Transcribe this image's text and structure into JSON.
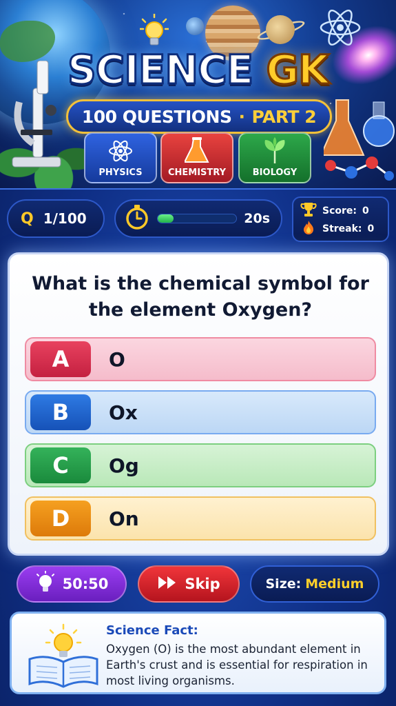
{
  "header": {
    "title_word1": "SCIENCE",
    "title_word2": "GK",
    "subtitle_left": "100 QUESTIONS",
    "subtitle_sep": "·",
    "subtitle_right": "PART 2",
    "categories": [
      {
        "label": "PHYSICS",
        "icon": "atom-icon",
        "color": "#2f63e0"
      },
      {
        "label": "CHEMISTRY",
        "icon": "flask-icon",
        "color": "#e8433f"
      },
      {
        "label": "BIOLOGY",
        "icon": "leaf-icon",
        "color": "#2da84a"
      }
    ]
  },
  "status": {
    "q_badge": "Q",
    "question_counter": "1/100",
    "timer_value": "20s",
    "timer_fraction": 0.2,
    "score_label": "Score:",
    "score_value": "0",
    "streak_label": "Streak:",
    "streak_value": "0"
  },
  "question": {
    "text": "What is the chemical symbol for the element Oxygen?",
    "options": [
      {
        "letter": "A",
        "text": "O",
        "color": "#e8425f"
      },
      {
        "letter": "B",
        "text": "Ox",
        "color": "#2e7ae3"
      },
      {
        "letter": "C",
        "text": "Og",
        "color": "#34b25a"
      },
      {
        "letter": "D",
        "text": "On",
        "color": "#f5a020"
      }
    ]
  },
  "controls": {
    "fifty_fifty_label": "50:50",
    "skip_label": "Skip",
    "size_label": "Size:",
    "size_value": "Medium"
  },
  "fact": {
    "title": "Science Fact:",
    "body": "Oxygen (O) is the most abundant element in Earth's crust and is essential for respiration in most living organisms."
  },
  "colors": {
    "accent_gold": "#ffcc2a",
    "primary_blue": "#0f2f86"
  }
}
